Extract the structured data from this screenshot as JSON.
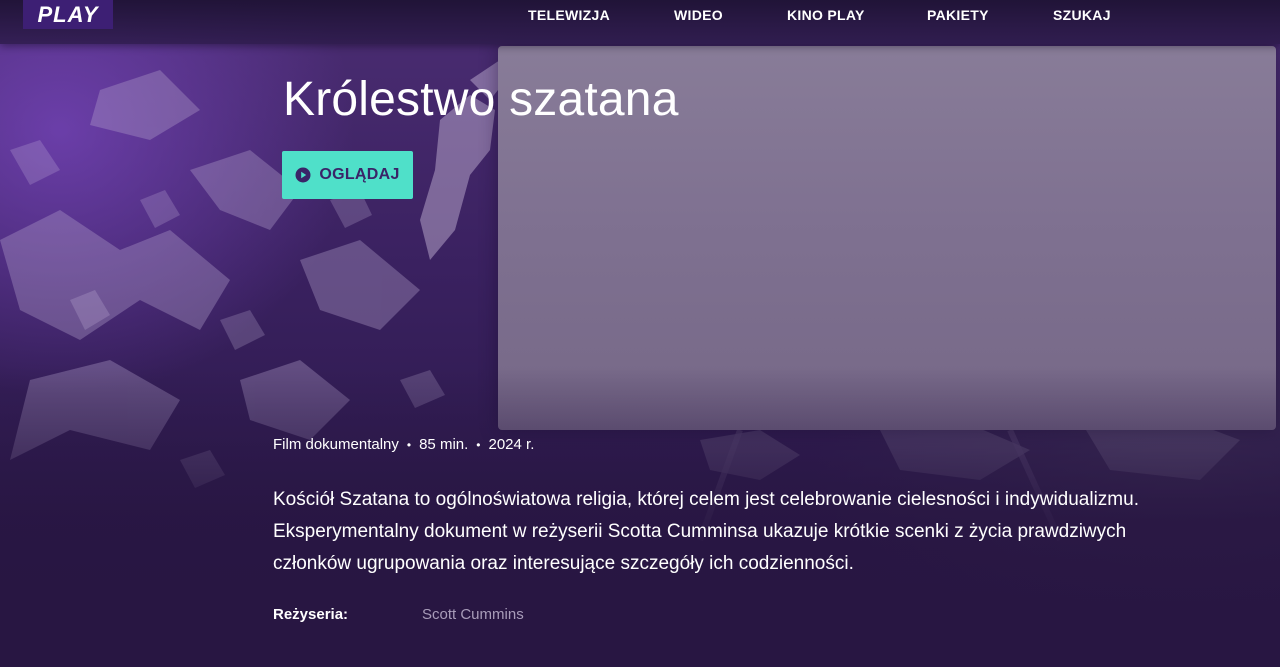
{
  "brand": {
    "logo_text": "PLAY",
    "accent_color": "#4fe0c9",
    "logo_bg": "#3d1f74"
  },
  "nav": {
    "items": [
      {
        "label": "TELEWIZJA"
      },
      {
        "label": "WIDEO"
      },
      {
        "label": "KINO PLAY"
      },
      {
        "label": "PAKIETY"
      },
      {
        "label": "SZUKAJ"
      }
    ]
  },
  "movie": {
    "title": "Królestwo szatana",
    "watch_label": "OGLĄDAJ",
    "watch_icon": "play-circle-icon",
    "genre": "Film dokumentalny",
    "duration": "85 min.",
    "year": "2024 r.",
    "separator": "•",
    "description": "Kościół Szatana to ogólnoświatowa religia, której celem jest celebrowanie cielesności i indywidualizmu. Eksperymentalny dokument w reżyserii Scotta Cumminsa ukazuje krótkie scenki z życia prawdziwych członków ugrupowania oraz interesujące szczegóły ich codzienności.",
    "director_label": "Reżyseria:",
    "director_name": "Scott Cummins"
  }
}
